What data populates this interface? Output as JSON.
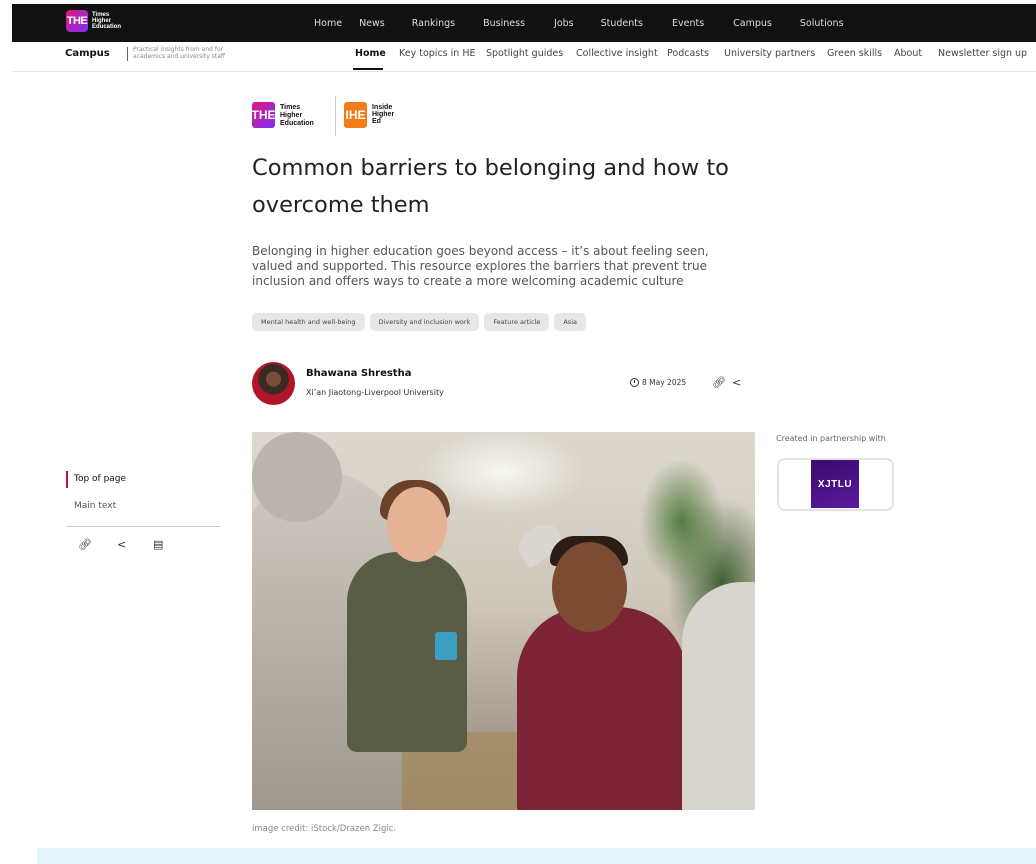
{
  "header": {
    "logo": {
      "mark": "THE",
      "lines": [
        "Times",
        "Higher",
        "Education"
      ]
    },
    "nav": [
      "Home",
      "News",
      "Rankings",
      "Business",
      "Jobs",
      "Students",
      "Events",
      "Campus",
      "Solutions"
    ]
  },
  "subheader": {
    "brand": "Campus",
    "tagline": "Practical insights from and for academics and university staff",
    "nav": [
      "Home",
      "Key topics in HE",
      "Spotlight guides",
      "Collective insight",
      "Podcasts",
      "University partners",
      "Green skills",
      "About",
      "Newsletter sign up"
    ],
    "active": "Home"
  },
  "partner_logos": {
    "the": {
      "mark": "THE",
      "lines": [
        "Times",
        "Higher",
        "Education"
      ]
    },
    "ihe": {
      "mark": "IHE",
      "lines": [
        "Inside",
        "Higher",
        "Ed"
      ]
    }
  },
  "article": {
    "title": "Common barriers to belonging and how to overcome them",
    "standfirst": "Belonging in higher education goes beyond access – it’s about feeling seen, valued and supported. This resource explores the barriers that prevent true inclusion and offers ways to create a more welcoming academic culture",
    "tags": [
      "Mental health and well-being",
      "Diversity and inclusion work",
      "Feature article",
      "Asia"
    ],
    "author": {
      "name": "Bhawana Shrestha",
      "institution": "Xi’an Jiaotong-Liverpool University"
    },
    "date": "8 May 2025",
    "image_credit": "image credit: iStock/Drazen Zigic."
  },
  "toc": {
    "items": [
      "Top of page",
      "Main text"
    ],
    "active": "Top of page"
  },
  "icons": {
    "link": "link-icon",
    "share": "share-icon",
    "comment": "comment-icon",
    "clock": "clock-icon"
  },
  "sidebar": {
    "partner_label": "Created in partnership with",
    "partner_name": "XJTLU"
  },
  "colors": {
    "accent_red": "#c8102e",
    "the_gradient_start": "#e0197d",
    "the_gradient_end": "#7b2ff7",
    "ihe_orange": "#f07d1a",
    "xjtlu_purple": "#3a0a6a",
    "footer_band": "#e6f4fb"
  }
}
